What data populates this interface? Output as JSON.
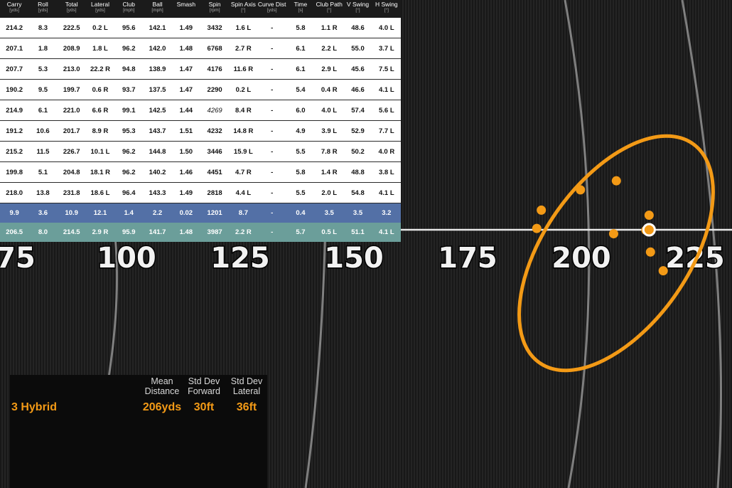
{
  "colors": {
    "accent_orange": "#f39a16",
    "sd_row": "#5370a6",
    "mean_row": "#6b9e9a",
    "header_bg": "#1b1b1b"
  },
  "table": {
    "columns": [
      {
        "label": "Carry",
        "unit": "[yds]"
      },
      {
        "label": "Roll",
        "unit": "[yds]"
      },
      {
        "label": "Total",
        "unit": "[yds]"
      },
      {
        "label": "Lateral",
        "unit": "[yds]"
      },
      {
        "label": "Club",
        "unit": "[mph]"
      },
      {
        "label": "Ball",
        "unit": "[mph]"
      },
      {
        "label": "Smash",
        "unit": ""
      },
      {
        "label": "Spin",
        "unit": "[rpm]"
      },
      {
        "label": "Spin Axis",
        "unit": "[°]"
      },
      {
        "label": "Curve Dist",
        "unit": "[yds]"
      },
      {
        "label": "Time",
        "unit": "[s]"
      },
      {
        "label": "Club Path",
        "unit": "[°]"
      },
      {
        "label": "V Swing",
        "unit": "[°]"
      },
      {
        "label": "H Swing",
        "unit": "[°]"
      }
    ],
    "rows": [
      [
        "214.2",
        "8.3",
        "222.5",
        "0.2 L",
        "95.6",
        "142.1",
        "1.49",
        "3432",
        "1.6 L",
        "-",
        "5.8",
        "1.1 R",
        "48.6",
        "4.0 L"
      ],
      [
        "207.1",
        "1.8",
        "208.9",
        "1.8 L",
        "96.2",
        "142.0",
        "1.48",
        "6768",
        "2.7 R",
        "-",
        "6.1",
        "2.2 L",
        "55.0",
        "3.7 L"
      ],
      [
        "207.7",
        "5.3",
        "213.0",
        "22.2 R",
        "94.8",
        "138.9",
        "1.47",
        "4176",
        "11.6 R",
        "-",
        "6.1",
        "2.9 L",
        "45.6",
        "7.5 L"
      ],
      [
        "190.2",
        "9.5",
        "199.7",
        "0.6 R",
        "93.7",
        "137.5",
        "1.47",
        "2290",
        "0.2 L",
        "-",
        "5.4",
        "0.4 R",
        "46.6",
        "4.1 L"
      ],
      [
        "214.9",
        "6.1",
        "221.0",
        "6.6 R",
        "99.1",
        "142.5",
        "1.44",
        "4269",
        "8.4 R",
        "-",
        "6.0",
        "4.0 L",
        "57.4",
        "5.6 L"
      ],
      [
        "191.2",
        "10.6",
        "201.7",
        "8.9 R",
        "95.3",
        "143.7",
        "1.51",
        "4232",
        "14.8 R",
        "-",
        "4.9",
        "3.9 L",
        "52.9",
        "7.7 L"
      ],
      [
        "215.2",
        "11.5",
        "226.7",
        "10.1 L",
        "96.2",
        "144.8",
        "1.50",
        "3446",
        "15.9 L",
        "-",
        "5.5",
        "7.8 R",
        "50.2",
        "4.0 R"
      ],
      [
        "199.8",
        "5.1",
        "204.8",
        "18.1 R",
        "96.2",
        "140.2",
        "1.46",
        "4451",
        "4.7 R",
        "-",
        "5.8",
        "1.4 R",
        "48.8",
        "3.8 L"
      ],
      [
        "218.0",
        "13.8",
        "231.8",
        "18.6 L",
        "96.4",
        "143.3",
        "1.49",
        "2818",
        "4.4 L",
        "-",
        "5.5",
        "2.0 L",
        "54.8",
        "4.1 L"
      ]
    ],
    "italic_cells": [
      [
        4,
        7
      ]
    ],
    "std_dev_row": [
      "9.9",
      "3.6",
      "10.9",
      "12.1",
      "1.4",
      "2.2",
      "0.02",
      "1201",
      "8.7",
      "-",
      "0.4",
      "3.5",
      "3.5",
      "3.2"
    ],
    "mean_row": [
      "206.5",
      "8.0",
      "214.5",
      "2.9 R",
      "95.9",
      "141.7",
      "1.48",
      "3987",
      "2.2 R",
      "-",
      "5.7",
      "0.5 L",
      "51.1",
      "4.1 L"
    ]
  },
  "range": {
    "distance_labels": [
      "75",
      "100",
      "125",
      "150",
      "175",
      "200",
      "225"
    ],
    "shots": [
      {
        "carry": 214.2,
        "lateral": -0.2
      },
      {
        "carry": 207.1,
        "lateral": -1.8
      },
      {
        "carry": 207.7,
        "lateral": 22.2
      },
      {
        "carry": 190.2,
        "lateral": 0.6
      },
      {
        "carry": 214.9,
        "lateral": 6.6
      },
      {
        "carry": 191.2,
        "lateral": 8.9
      },
      {
        "carry": 215.2,
        "lateral": -10.1
      },
      {
        "carry": 199.8,
        "lateral": 18.1
      },
      {
        "carry": 218.0,
        "lateral": -18.6
      }
    ],
    "mean_shot": {
      "carry": 214.9,
      "lateral": 0.0
    }
  },
  "summary": {
    "club": "3 Hybrid",
    "headers": [
      [
        "Mean",
        "Distance"
      ],
      [
        "Std Dev",
        "Forward"
      ],
      [
        "Std Dev",
        "Lateral"
      ]
    ],
    "values": [
      "206yds",
      "30ft",
      "36ft"
    ]
  }
}
